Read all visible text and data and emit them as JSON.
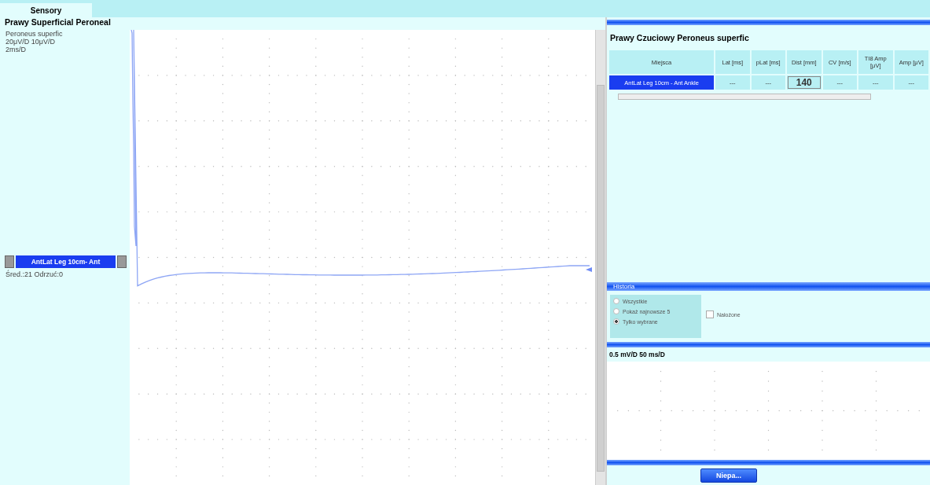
{
  "tabs": [
    {
      "label": "Sensory",
      "selected": true
    }
  ],
  "left": {
    "title": "Prawy Superficial Peroneal",
    "nerve": "Peroneus superfic",
    "sensitivity": "20μV/D  10μV/D",
    "sweep": "2ms/D",
    "trace_label": "AntLat Leg 10cm- Ant",
    "stats": "Śred.:21  Odrzuć:0"
  },
  "right": {
    "title": "Prawy Czuciowy Peroneus superfic",
    "table": {
      "columns": [
        "Miejsca",
        "Lat [ms]",
        "pLat [ms]",
        "Dist [mm]",
        "CV [m/s]",
        "TI8 Amp [μV]",
        "Amp [μV]"
      ],
      "rows": [
        {
          "selected": true,
          "cells": [
            "AntLat Leg 10cm - Ant Ankle",
            "---",
            "---",
            "140",
            "---",
            "---",
            "---"
          ]
        }
      ]
    },
    "history": {
      "title": "Historia",
      "options": [
        {
          "label": "Wszystkie",
          "selected": false
        },
        {
          "label": "Pokaż najnowsze  5",
          "selected": false
        },
        {
          "label": "Tylko wybrane",
          "selected": true
        }
      ],
      "overlay": {
        "label": "Nałożone",
        "checked": false
      }
    },
    "scale": "0.5 mV/D 50 ms/D",
    "button": "Niepa..."
  }
}
